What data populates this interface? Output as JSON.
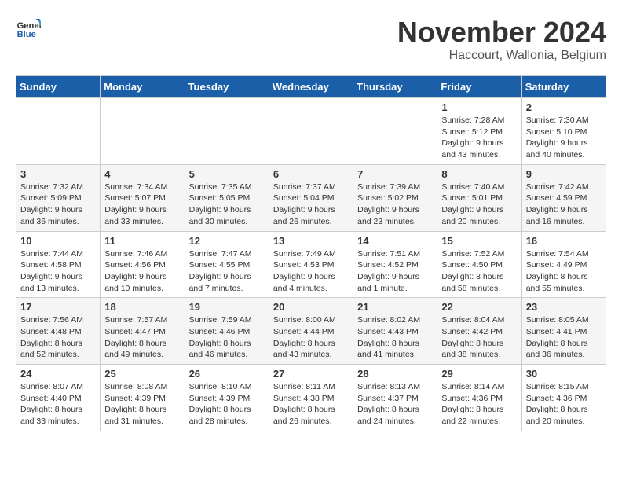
{
  "logo": {
    "general": "General",
    "blue": "Blue"
  },
  "title": "November 2024",
  "location": "Haccourt, Wallonia, Belgium",
  "days_of_week": [
    "Sunday",
    "Monday",
    "Tuesday",
    "Wednesday",
    "Thursday",
    "Friday",
    "Saturday"
  ],
  "weeks": [
    [
      {
        "day": "",
        "sunrise": "",
        "sunset": "",
        "daylight": ""
      },
      {
        "day": "",
        "sunrise": "",
        "sunset": "",
        "daylight": ""
      },
      {
        "day": "",
        "sunrise": "",
        "sunset": "",
        "daylight": ""
      },
      {
        "day": "",
        "sunrise": "",
        "sunset": "",
        "daylight": ""
      },
      {
        "day": "",
        "sunrise": "",
        "sunset": "",
        "daylight": ""
      },
      {
        "day": "1",
        "sunrise": "Sunrise: 7:28 AM",
        "sunset": "Sunset: 5:12 PM",
        "daylight": "Daylight: 9 hours and 43 minutes."
      },
      {
        "day": "2",
        "sunrise": "Sunrise: 7:30 AM",
        "sunset": "Sunset: 5:10 PM",
        "daylight": "Daylight: 9 hours and 40 minutes."
      }
    ],
    [
      {
        "day": "3",
        "sunrise": "Sunrise: 7:32 AM",
        "sunset": "Sunset: 5:09 PM",
        "daylight": "Daylight: 9 hours and 36 minutes."
      },
      {
        "day": "4",
        "sunrise": "Sunrise: 7:34 AM",
        "sunset": "Sunset: 5:07 PM",
        "daylight": "Daylight: 9 hours and 33 minutes."
      },
      {
        "day": "5",
        "sunrise": "Sunrise: 7:35 AM",
        "sunset": "Sunset: 5:05 PM",
        "daylight": "Daylight: 9 hours and 30 minutes."
      },
      {
        "day": "6",
        "sunrise": "Sunrise: 7:37 AM",
        "sunset": "Sunset: 5:04 PM",
        "daylight": "Daylight: 9 hours and 26 minutes."
      },
      {
        "day": "7",
        "sunrise": "Sunrise: 7:39 AM",
        "sunset": "Sunset: 5:02 PM",
        "daylight": "Daylight: 9 hours and 23 minutes."
      },
      {
        "day": "8",
        "sunrise": "Sunrise: 7:40 AM",
        "sunset": "Sunset: 5:01 PM",
        "daylight": "Daylight: 9 hours and 20 minutes."
      },
      {
        "day": "9",
        "sunrise": "Sunrise: 7:42 AM",
        "sunset": "Sunset: 4:59 PM",
        "daylight": "Daylight: 9 hours and 16 minutes."
      }
    ],
    [
      {
        "day": "10",
        "sunrise": "Sunrise: 7:44 AM",
        "sunset": "Sunset: 4:58 PM",
        "daylight": "Daylight: 9 hours and 13 minutes."
      },
      {
        "day": "11",
        "sunrise": "Sunrise: 7:46 AM",
        "sunset": "Sunset: 4:56 PM",
        "daylight": "Daylight: 9 hours and 10 minutes."
      },
      {
        "day": "12",
        "sunrise": "Sunrise: 7:47 AM",
        "sunset": "Sunset: 4:55 PM",
        "daylight": "Daylight: 9 hours and 7 minutes."
      },
      {
        "day": "13",
        "sunrise": "Sunrise: 7:49 AM",
        "sunset": "Sunset: 4:53 PM",
        "daylight": "Daylight: 9 hours and 4 minutes."
      },
      {
        "day": "14",
        "sunrise": "Sunrise: 7:51 AM",
        "sunset": "Sunset: 4:52 PM",
        "daylight": "Daylight: 9 hours and 1 minute."
      },
      {
        "day": "15",
        "sunrise": "Sunrise: 7:52 AM",
        "sunset": "Sunset: 4:50 PM",
        "daylight": "Daylight: 8 hours and 58 minutes."
      },
      {
        "day": "16",
        "sunrise": "Sunrise: 7:54 AM",
        "sunset": "Sunset: 4:49 PM",
        "daylight": "Daylight: 8 hours and 55 minutes."
      }
    ],
    [
      {
        "day": "17",
        "sunrise": "Sunrise: 7:56 AM",
        "sunset": "Sunset: 4:48 PM",
        "daylight": "Daylight: 8 hours and 52 minutes."
      },
      {
        "day": "18",
        "sunrise": "Sunrise: 7:57 AM",
        "sunset": "Sunset: 4:47 PM",
        "daylight": "Daylight: 8 hours and 49 minutes."
      },
      {
        "day": "19",
        "sunrise": "Sunrise: 7:59 AM",
        "sunset": "Sunset: 4:46 PM",
        "daylight": "Daylight: 8 hours and 46 minutes."
      },
      {
        "day": "20",
        "sunrise": "Sunrise: 8:00 AM",
        "sunset": "Sunset: 4:44 PM",
        "daylight": "Daylight: 8 hours and 43 minutes."
      },
      {
        "day": "21",
        "sunrise": "Sunrise: 8:02 AM",
        "sunset": "Sunset: 4:43 PM",
        "daylight": "Daylight: 8 hours and 41 minutes."
      },
      {
        "day": "22",
        "sunrise": "Sunrise: 8:04 AM",
        "sunset": "Sunset: 4:42 PM",
        "daylight": "Daylight: 8 hours and 38 minutes."
      },
      {
        "day": "23",
        "sunrise": "Sunrise: 8:05 AM",
        "sunset": "Sunset: 4:41 PM",
        "daylight": "Daylight: 8 hours and 36 minutes."
      }
    ],
    [
      {
        "day": "24",
        "sunrise": "Sunrise: 8:07 AM",
        "sunset": "Sunset: 4:40 PM",
        "daylight": "Daylight: 8 hours and 33 minutes."
      },
      {
        "day": "25",
        "sunrise": "Sunrise: 8:08 AM",
        "sunset": "Sunset: 4:39 PM",
        "daylight": "Daylight: 8 hours and 31 minutes."
      },
      {
        "day": "26",
        "sunrise": "Sunrise: 8:10 AM",
        "sunset": "Sunset: 4:39 PM",
        "daylight": "Daylight: 8 hours and 28 minutes."
      },
      {
        "day": "27",
        "sunrise": "Sunrise: 8:11 AM",
        "sunset": "Sunset: 4:38 PM",
        "daylight": "Daylight: 8 hours and 26 minutes."
      },
      {
        "day": "28",
        "sunrise": "Sunrise: 8:13 AM",
        "sunset": "Sunset: 4:37 PM",
        "daylight": "Daylight: 8 hours and 24 minutes."
      },
      {
        "day": "29",
        "sunrise": "Sunrise: 8:14 AM",
        "sunset": "Sunset: 4:36 PM",
        "daylight": "Daylight: 8 hours and 22 minutes."
      },
      {
        "day": "30",
        "sunrise": "Sunrise: 8:15 AM",
        "sunset": "Sunset: 4:36 PM",
        "daylight": "Daylight: 8 hours and 20 minutes."
      }
    ]
  ]
}
